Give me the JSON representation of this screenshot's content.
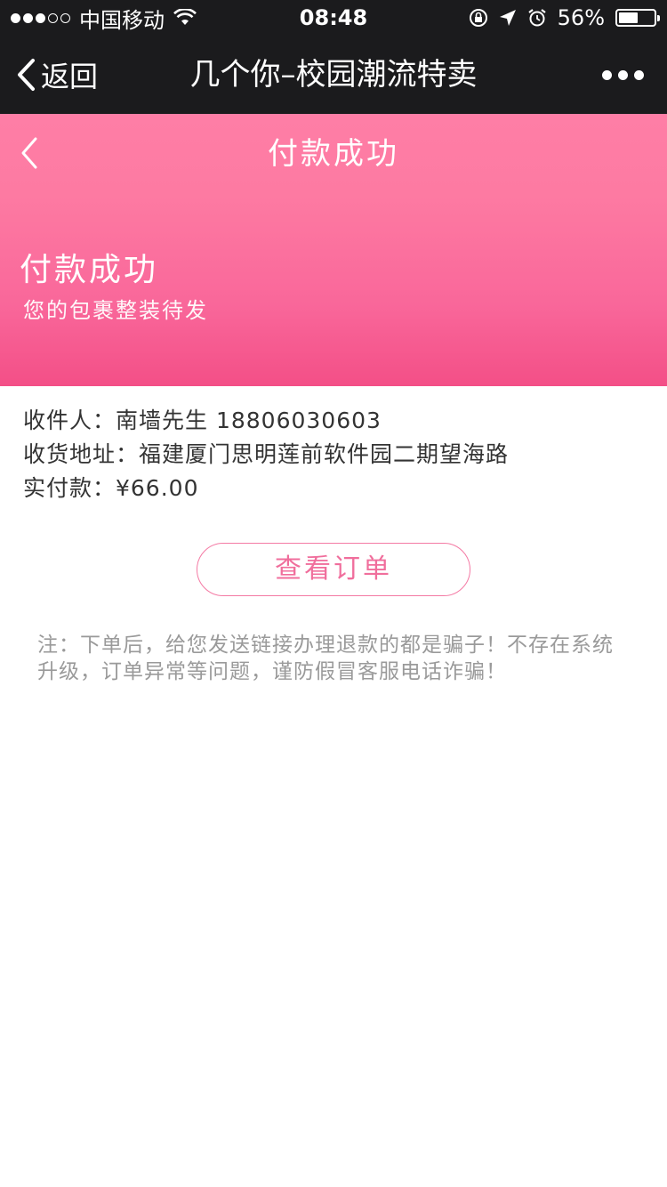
{
  "status_bar": {
    "carrier": "中国移动",
    "time": "08:48",
    "battery_percent": "56%",
    "battery_level": 0.56,
    "signal_bars_filled": 3,
    "signal_bars_total": 5,
    "icons": [
      "wifi-icon",
      "rotation-lock-icon",
      "location-arrow-icon",
      "alarm-icon",
      "battery-icon"
    ]
  },
  "wechat_nav": {
    "back_label": "返回",
    "title": "几个你–校园潮流特卖",
    "more_icon": "more-dots-icon"
  },
  "hero": {
    "nav_title": "付款成功",
    "headline": "付款成功",
    "subtitle": "您的包裹整装待发",
    "colors": {
      "top": "#fe7ea6",
      "bottom": "#f34f87"
    }
  },
  "order_info": {
    "recipient": "收件人：南墙先生 18806030603",
    "address": "收货地址：福建厦门思明莲前软件园二期望海路",
    "paid": "实付款：¥66.00"
  },
  "actions": {
    "view_order_label": "查看订单"
  },
  "notice": "注：下单后，给您发送链接办理退款的都是骗子！不存在系统升级，订单异常等问题，谨防假冒客服电话诈骗！",
  "colors": {
    "accent": "#f06e9c",
    "nav_background": "#1b1b1d",
    "notice_text": "#9a9a9a"
  }
}
